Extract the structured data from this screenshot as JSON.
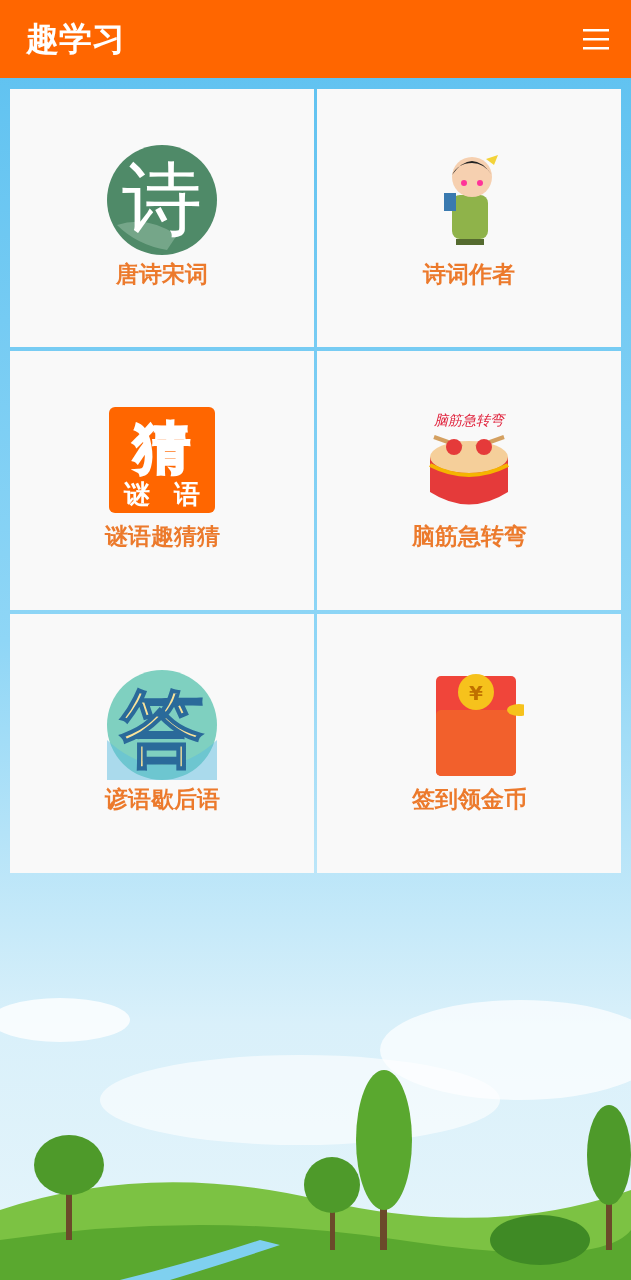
{
  "header": {
    "title": "趣学习"
  },
  "tiles": [
    {
      "label": "唐诗宋词",
      "kind": "poem",
      "glyphs": [
        "诗"
      ]
    },
    {
      "label": "诗词作者",
      "kind": "scholar"
    },
    {
      "label": "谜语趣猜猜",
      "kind": "riddle",
      "glyphs": [
        "猜",
        "谜",
        "语"
      ]
    },
    {
      "label": "脑筋急转弯",
      "kind": "drum",
      "glyphs": [
        "脑筋急转弯"
      ]
    },
    {
      "label": "谚语歇后语",
      "kind": "answer",
      "glyphs": [
        "答"
      ]
    },
    {
      "label": "签到领金币",
      "kind": "envelope",
      "glyphs": [
        "¥"
      ]
    }
  ]
}
